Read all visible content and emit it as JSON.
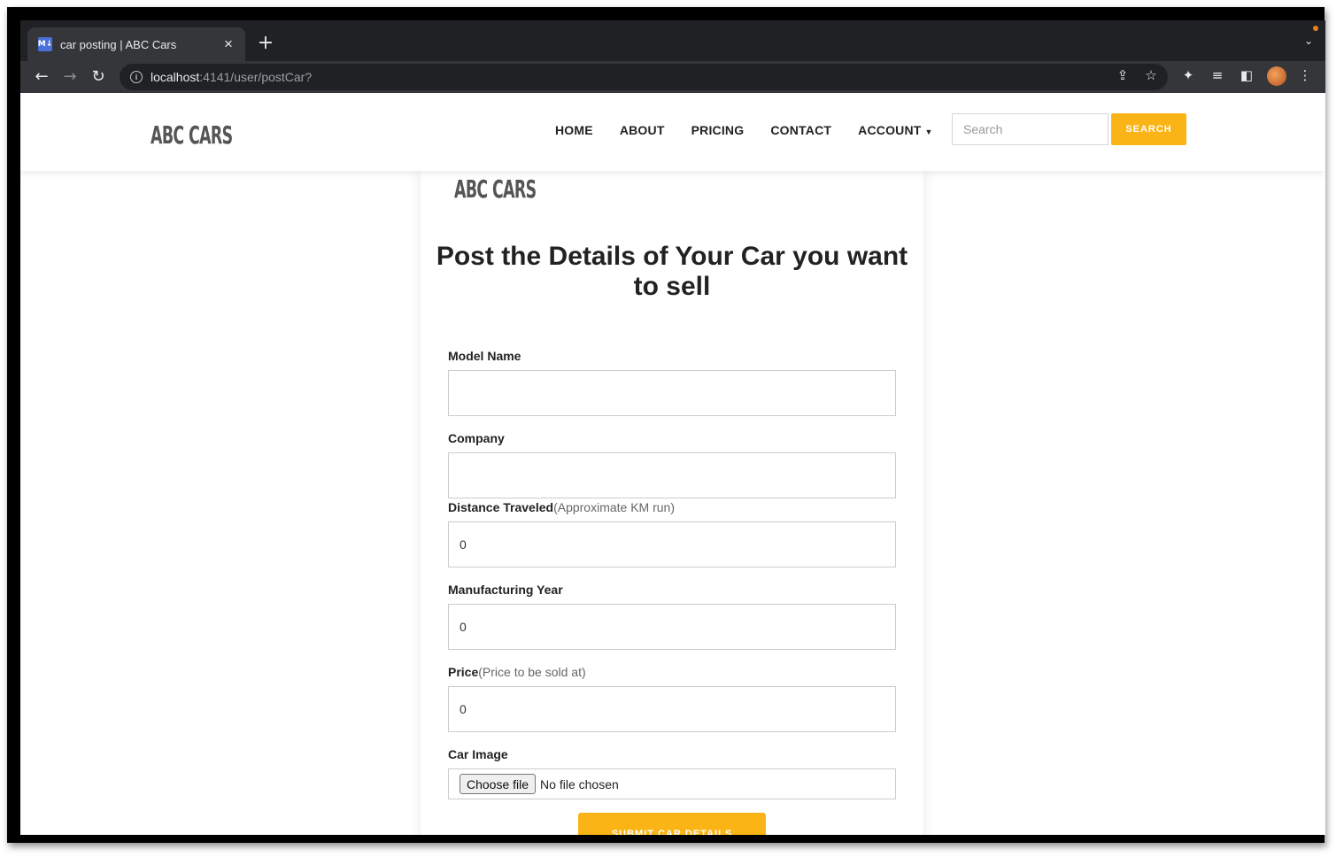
{
  "browser": {
    "tab_title": "car posting | ABC Cars",
    "favicon_text": "M↓",
    "url_host": "localhost",
    "url_rest": ":4141/user/postCar?"
  },
  "site": {
    "logo": "ABC CARS",
    "nav": [
      "HOME",
      "ABOUT",
      "PRICING",
      "CONTACT",
      "ACCOUNT"
    ],
    "search_placeholder": "Search",
    "search_button": "SEARCH"
  },
  "form": {
    "logo": "ABC CARS",
    "title": "Post the Details of Your Car you want to sell",
    "fields": [
      {
        "label": "Model Name",
        "hint": "",
        "value": ""
      },
      {
        "label": "Company",
        "hint": "",
        "value": ""
      },
      {
        "label": "Distance Traveled",
        "hint": "(Approximate KM run)",
        "value": "0"
      },
      {
        "label": "Manufacturing Year",
        "hint": "",
        "value": "0"
      },
      {
        "label": "Price",
        "hint": "(Price to be sold at)",
        "value": "0"
      }
    ],
    "image_label": "Car Image",
    "file_button": "Choose file",
    "file_status": "No file chosen",
    "submit": "SUBMIT CAR DETAILS"
  },
  "colors": {
    "accent": "#fbb416",
    "browser_dark": "#202124",
    "browser_toolbar": "#35363a"
  }
}
